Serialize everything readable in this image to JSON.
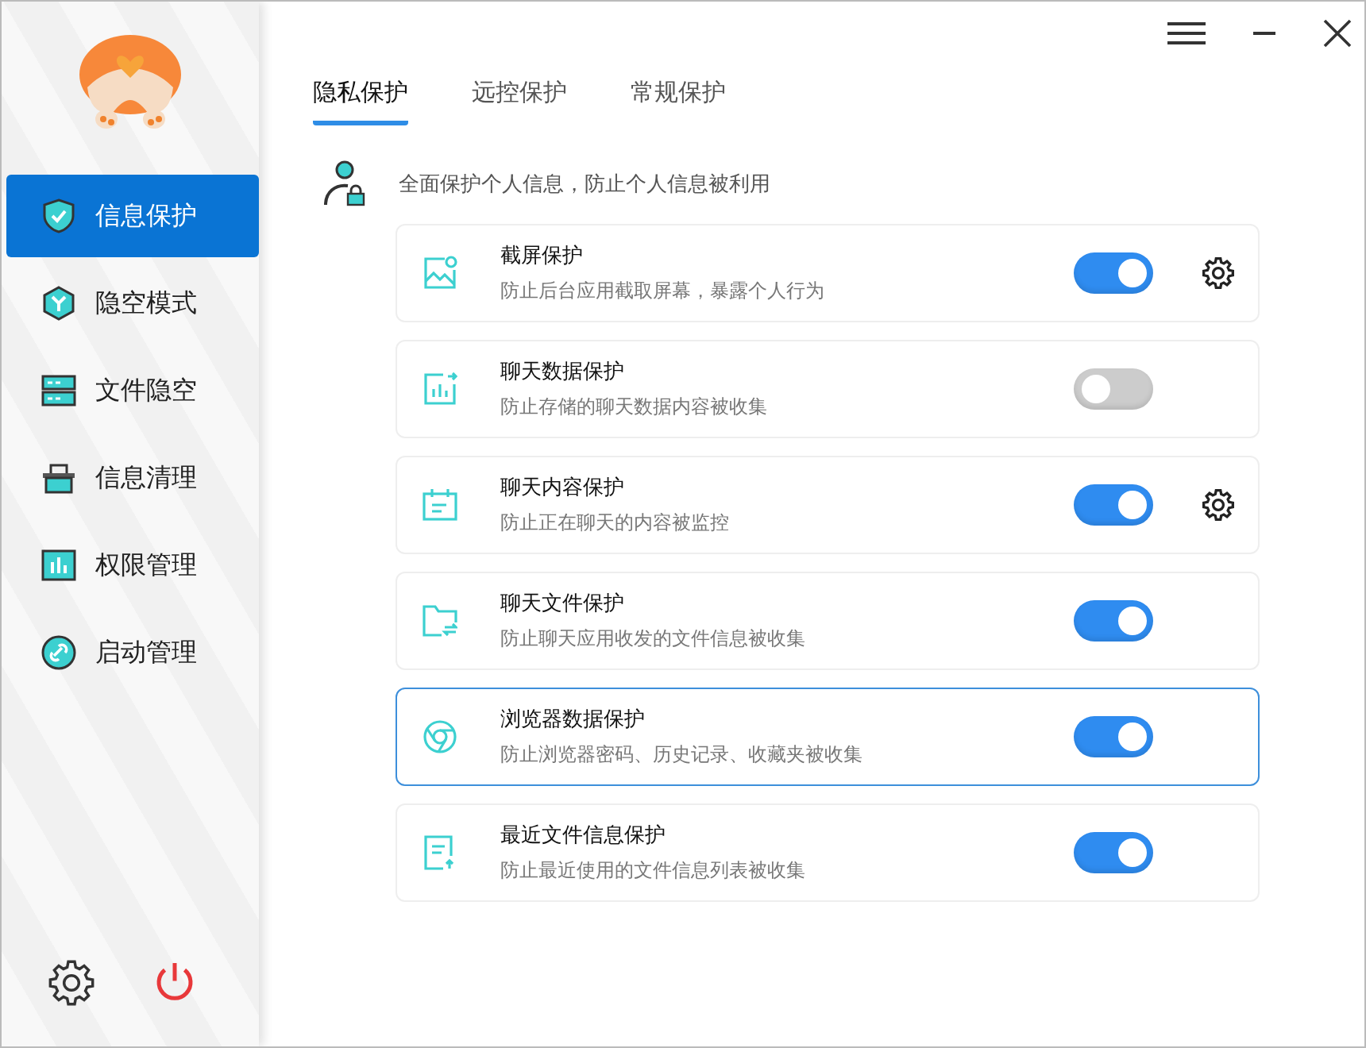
{
  "sidebar": {
    "items": [
      {
        "label": "信息保护",
        "kind": "shield",
        "selected": true
      },
      {
        "label": "隐空模式",
        "kind": "hexagon",
        "selected": false
      },
      {
        "label": "文件隐空",
        "kind": "server",
        "selected": false
      },
      {
        "label": "信息清理",
        "kind": "basket",
        "selected": false
      },
      {
        "label": "权限管理",
        "kind": "chart",
        "selected": false
      },
      {
        "label": "启动管理",
        "kind": "link",
        "selected": false
      }
    ]
  },
  "tabs": [
    {
      "label": "隐私保护",
      "selected": true
    },
    {
      "label": "远控保护",
      "selected": false
    },
    {
      "label": "常规保护",
      "selected": false
    }
  ],
  "intro": "全面保护个人信息，防止个人信息被利用",
  "items": [
    {
      "kind": "image",
      "title": "截屏保护",
      "desc": "防止后台应用截取屏幕，暴露个人行为",
      "on": true,
      "has_settings": true,
      "selected": false
    },
    {
      "kind": "stats",
      "title": "聊天数据保护",
      "desc": "防止存储的聊天数据内容被收集",
      "on": false,
      "has_settings": false,
      "selected": false
    },
    {
      "kind": "calendar",
      "title": "聊天内容保护",
      "desc": "防止正在聊天的内容被监控",
      "on": true,
      "has_settings": true,
      "selected": false
    },
    {
      "kind": "folder",
      "title": "聊天文件保护",
      "desc": "防止聊天应用收发的文件信息被收集",
      "on": true,
      "has_settings": false,
      "selected": false
    },
    {
      "kind": "browser",
      "title": "浏览器数据保护",
      "desc": "防止浏览器密码、历史记录、收藏夹被收集",
      "on": true,
      "has_settings": false,
      "selected": true
    },
    {
      "kind": "document",
      "title": "最近文件信息保护",
      "desc": "防止最近使用的文件信息列表被收集",
      "on": true,
      "has_settings": false,
      "selected": false
    }
  ]
}
